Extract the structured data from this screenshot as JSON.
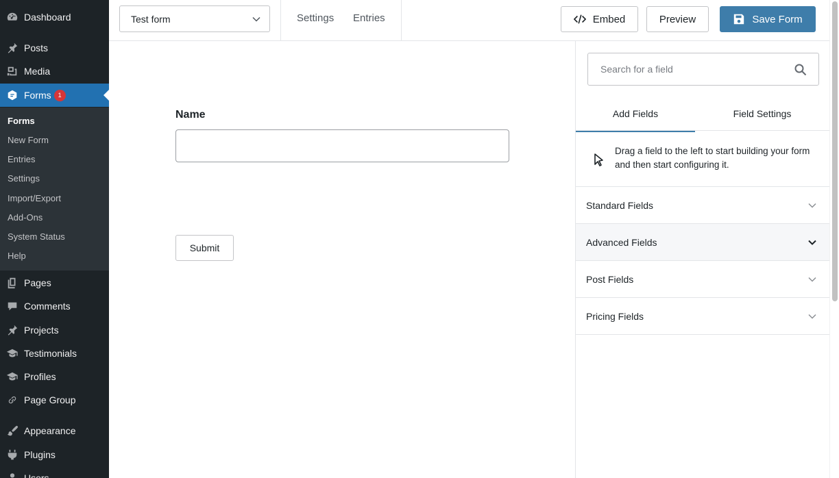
{
  "sidebar": {
    "items": [
      {
        "label": "Dashboard",
        "icon": "dashboard-icon"
      },
      {
        "label": "Posts",
        "icon": "pin-icon"
      },
      {
        "label": "Media",
        "icon": "media-icon"
      },
      {
        "label": "Forms",
        "icon": "forms-icon",
        "badge": "1",
        "current": true
      },
      {
        "label": "Pages",
        "icon": "pages-icon"
      },
      {
        "label": "Comments",
        "icon": "comment-icon"
      },
      {
        "label": "Projects",
        "icon": "pin-icon"
      },
      {
        "label": "Testimonials",
        "icon": "hat-icon"
      },
      {
        "label": "Profiles",
        "icon": "hat-icon"
      },
      {
        "label": "Page Group",
        "icon": "link-icon"
      },
      {
        "label": "Appearance",
        "icon": "brush-icon"
      },
      {
        "label": "Plugins",
        "icon": "plugin-icon"
      },
      {
        "label": "Users",
        "icon": "users-icon"
      }
    ],
    "submenu": [
      "Forms",
      "New Form",
      "Entries",
      "Settings",
      "Import/Export",
      "Add-Ons",
      "System Status",
      "Help"
    ]
  },
  "toolbar": {
    "form_select_value": "Test form",
    "settings_label": "Settings",
    "entries_label": "Entries",
    "embed_label": "Embed",
    "preview_label": "Preview",
    "save_label": "Save Form"
  },
  "canvas": {
    "field_label": "Name",
    "submit_label": "Submit"
  },
  "editor_sidebar": {
    "search_placeholder": "Search for a field",
    "tabs": [
      "Add Fields",
      "Field Settings"
    ],
    "hint": "Drag a field to the left to start building your form and then start configuring it.",
    "groups": [
      "Standard Fields",
      "Advanced Fields",
      "Post Fields",
      "Pricing Fields"
    ]
  },
  "colors": {
    "admin_bg": "#1d2327",
    "submenu_bg": "#2c3338",
    "accent": "#2271b1",
    "save_button": "#3e7daa",
    "badge": "#d63638"
  }
}
